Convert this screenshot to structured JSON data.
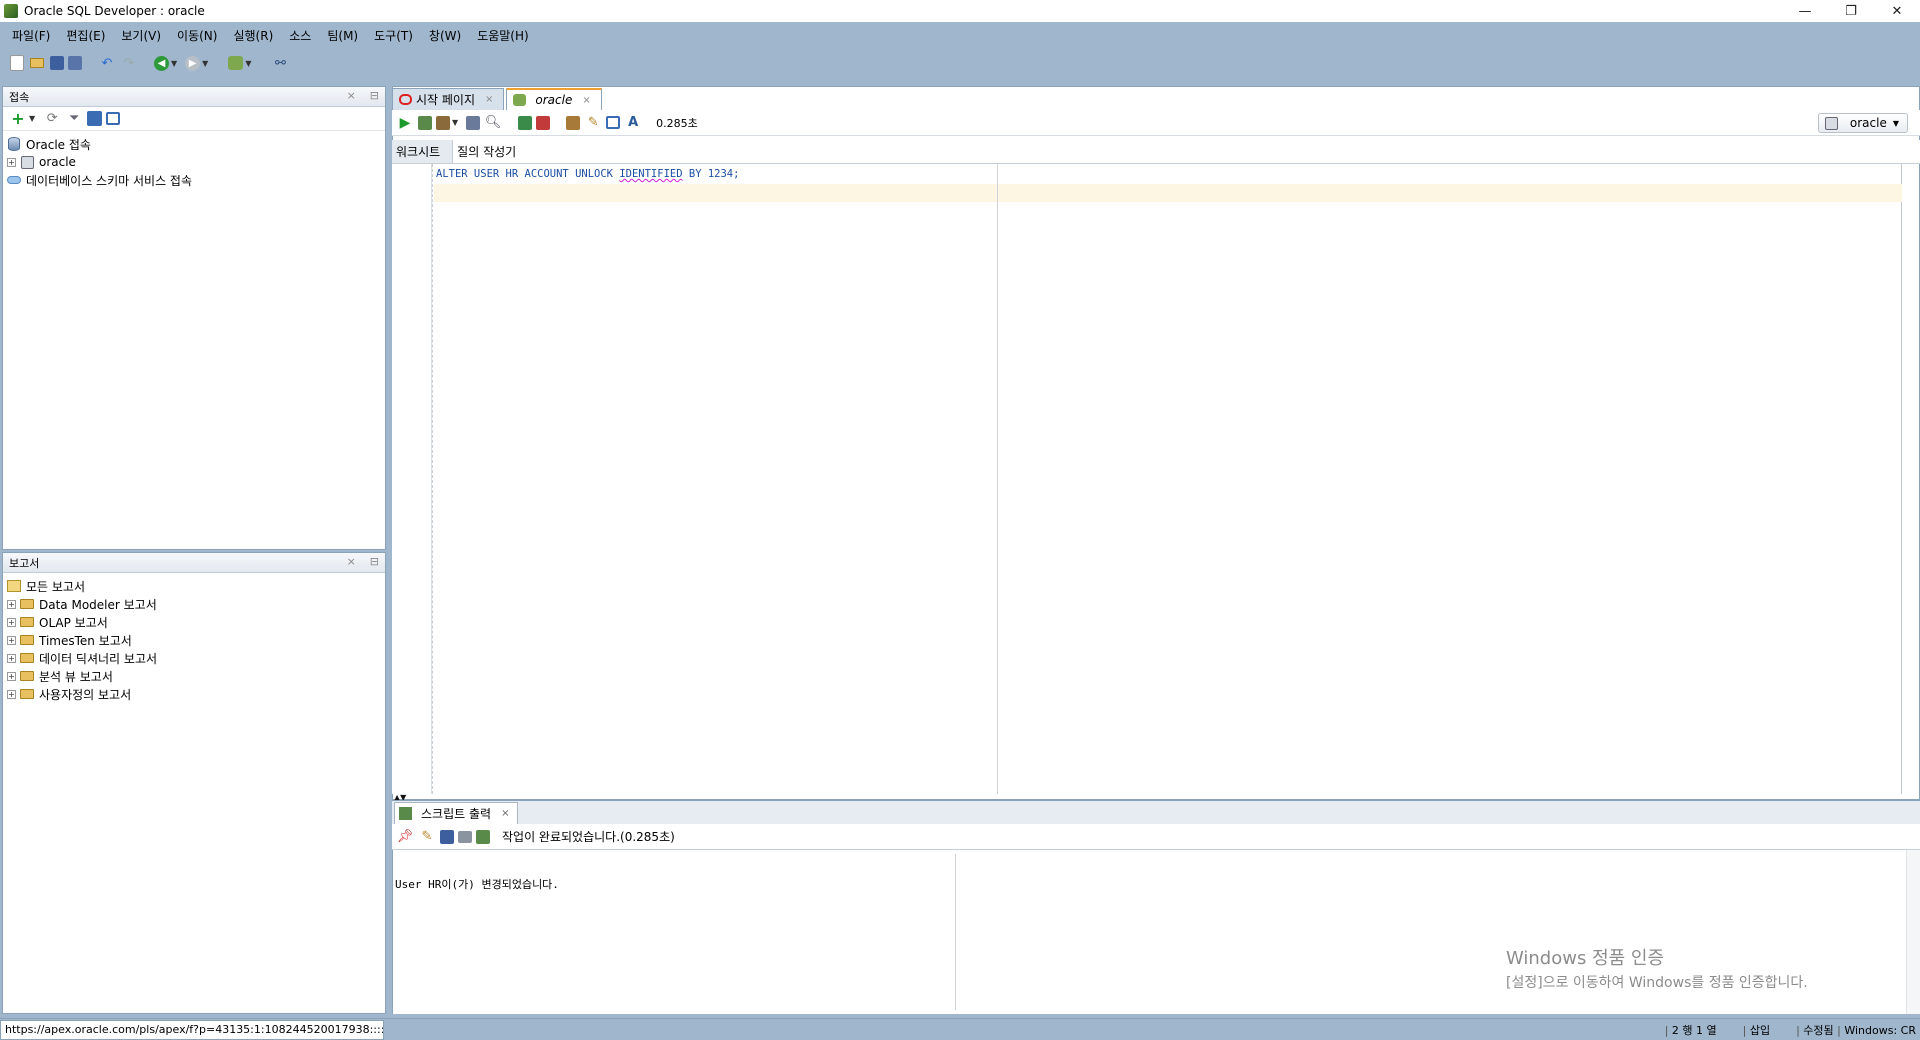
{
  "window": {
    "title": "Oracle SQL Developer : oracle",
    "controls": {
      "minimize": "—",
      "restore": "❐",
      "close": "✕"
    }
  },
  "menu": [
    "파일(F)",
    "편집(E)",
    "보기(V)",
    "이동(N)",
    "실행(R)",
    "소스",
    "팀(M)",
    "도구(T)",
    "창(W)",
    "도움말(H)"
  ],
  "connections_panel": {
    "title": "접속",
    "tree": [
      {
        "label": "Oracle 접속",
        "icon": "database-icon"
      },
      {
        "label": "oracle",
        "icon": "connection-icon"
      },
      {
        "label": "데이터베이스 스키마 서비스 접속",
        "icon": "cloud-icon"
      }
    ]
  },
  "reports_panel": {
    "title": "보고서",
    "tree": [
      {
        "label": "모든 보고서"
      },
      {
        "label": "Data Modeler 보고서"
      },
      {
        "label": "OLAP 보고서"
      },
      {
        "label": "TimesTen 보고서"
      },
      {
        "label": "데이터 딕셔너리 보고서"
      },
      {
        "label": "분석 뷰 보고서"
      },
      {
        "label": "사용자정의 보고서"
      }
    ]
  },
  "editor": {
    "tabs": [
      {
        "label": "시작 페이지"
      },
      {
        "label": "oracle",
        "active": true
      }
    ],
    "exec_time": "0.285초",
    "connection": "oracle",
    "subtabs": [
      "워크시트",
      "질의 작성기"
    ],
    "code": {
      "before": "ALTER USER HR ACCOUNT UNLOCK ",
      "flagged": "IDENTIFIED",
      "after": " BY 1234;"
    }
  },
  "output": {
    "tab_label": "스크립트 출력",
    "status": "작업이 완료되었습니다.(0.285초)",
    "text": "User HR이(가) 변경되었습니다."
  },
  "watermark": {
    "line1": "Windows 정품 인증",
    "line2": "[설정]으로 이동하여 Windows를 정품 인증합니다."
  },
  "statusbar": {
    "url": "https://apex.oracle.com/pls/apex/f?p=43135:1:108244520017938:::::",
    "position": "2 행 1 열",
    "mode": "삽입",
    "modified": "수정됨",
    "line_ending": "Windows: CR"
  },
  "colors": {
    "chrome": "#9fb6cd",
    "keyword": "#1b4ea3",
    "current_line": "#fdf6e3",
    "active_tab_accent": "#f0a030"
  }
}
